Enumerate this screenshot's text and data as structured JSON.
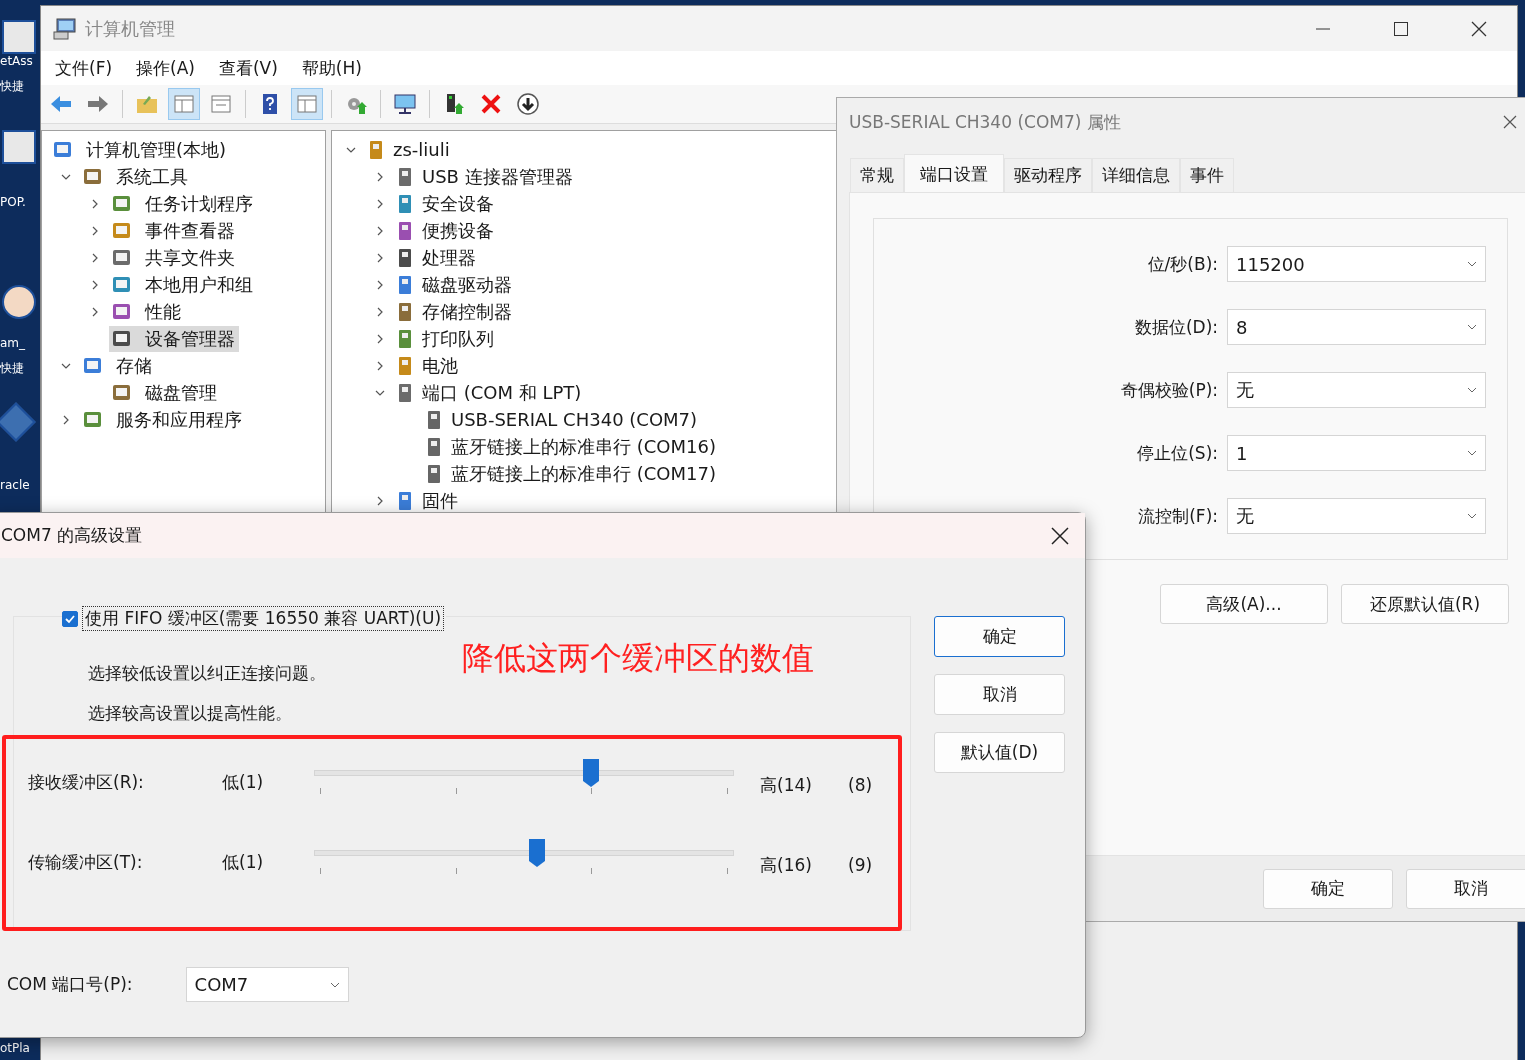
{
  "desktop": {
    "labels": [
      {
        "text": "etAss"
      },
      {
        "text": "快捷"
      },
      {
        "text": "POP."
      },
      {
        "text": "am_"
      },
      {
        "text": "快捷"
      },
      {
        "text": "racle"
      },
      {
        "text": "otPla"
      }
    ]
  },
  "main_window": {
    "title": "计算机管理",
    "menu": [
      "文件(F)",
      "操作(A)",
      "查看(V)",
      "帮助(H)"
    ],
    "toolbar": [
      {
        "kind": "back",
        "selected": false
      },
      {
        "kind": "forward",
        "selected": false
      },
      {
        "kind": "folder",
        "selected": false
      },
      {
        "kind": "tree",
        "selected": true
      },
      {
        "kind": "sheet",
        "selected": false
      },
      {
        "kind": "help",
        "selected": false
      },
      {
        "kind": "pane",
        "selected": true
      },
      {
        "kind": "gear",
        "selected": false
      },
      {
        "kind": "monitor",
        "selected": false
      },
      {
        "kind": "device",
        "selected": false
      },
      {
        "kind": "delete",
        "selected": false
      },
      {
        "kind": "download",
        "selected": false
      }
    ],
    "console_tree": [
      {
        "label": "计算机管理(本地)",
        "selected": false,
        "children": [
          {
            "label": "系统工具",
            "expanded": true,
            "selected": false,
            "children": [
              {
                "label": "任务计划程序",
                "expanded": false,
                "selected": false
              },
              {
                "label": "事件查看器",
                "expanded": false,
                "selected": false
              },
              {
                "label": "共享文件夹",
                "expanded": false,
                "selected": false
              },
              {
                "label": "本地用户和组",
                "expanded": false,
                "selected": false
              },
              {
                "label": "性能",
                "expanded": false,
                "selected": false
              },
              {
                "label": "设备管理器",
                "selected": true
              }
            ]
          },
          {
            "label": "存储",
            "expanded": true,
            "selected": false,
            "children": [
              {
                "label": "磁盘管理",
                "selected": false
              }
            ]
          },
          {
            "label": "服务和应用程序",
            "expanded": false,
            "selected": false
          }
        ]
      }
    ],
    "device_tree": [
      {
        "label": "zs-liuli",
        "expanded": true,
        "children": [
          {
            "label": "USB 连接器管理器",
            "expanded": false
          },
          {
            "label": "安全设备",
            "expanded": false
          },
          {
            "label": "便携设备",
            "expanded": false
          },
          {
            "label": "处理器",
            "expanded": false
          },
          {
            "label": "磁盘驱动器",
            "expanded": false
          },
          {
            "label": "存储控制器",
            "expanded": false
          },
          {
            "label": "打印队列",
            "expanded": false
          },
          {
            "label": "电池",
            "expanded": false
          },
          {
            "label": "端口 (COM 和 LPT)",
            "expanded": true,
            "children": [
              {
                "label": "USB-SERIAL CH340 (COM7)"
              },
              {
                "label": "蓝牙链接上的标准串行 (COM16)"
              },
              {
                "label": "蓝牙链接上的标准串行 (COM17)"
              }
            ]
          },
          {
            "label": "固件",
            "expanded": false
          }
        ]
      }
    ]
  },
  "properties_dialog": {
    "title": "USB-SERIAL CH340 (COM7) 属性",
    "tabs": [
      {
        "label": "常规",
        "selected": false
      },
      {
        "label": "端口设置",
        "selected": true
      },
      {
        "label": "驱动程序",
        "selected": false
      },
      {
        "label": "详细信息",
        "selected": false
      },
      {
        "label": "事件",
        "selected": false
      }
    ],
    "fields": [
      {
        "label": "位/秒(B):",
        "value": "115200"
      },
      {
        "label": "数据位(D):",
        "value": "8"
      },
      {
        "label": "奇偶校验(P):",
        "value": "无"
      },
      {
        "label": "停止位(S):",
        "value": "1"
      },
      {
        "label": "流控制(F):",
        "value": "无"
      }
    ],
    "buttons": [
      "高级(A)...",
      "还原默认值(R)"
    ],
    "footer_buttons": [
      "确定",
      "取消"
    ]
  },
  "advanced_dialog": {
    "title": "COM7 的高级设置",
    "fifo": {
      "label": "使用 FIFO 缓冲区(需要 16550 兼容 UART)(U)",
      "checked": true
    },
    "hints": [
      "选择较低设置以纠正连接问题。",
      "选择较高设置以提高性能。"
    ],
    "buffers": [
      {
        "label": "接收缓冲区(R):",
        "low": "低(1)",
        "high": "高(14)",
        "reading": "(8)",
        "level": 0.66
      },
      {
        "label": "传输缓冲区(T):",
        "low": "低(1)",
        "high": "高(16)",
        "reading": "(9)",
        "level": 0.53
      }
    ],
    "buttons": [
      {
        "label": "确定",
        "default": true
      },
      {
        "label": "取消",
        "default": false
      },
      {
        "label": "默认值(D)",
        "default": false
      }
    ],
    "com_port": {
      "label": "COM 端口号(P):",
      "value": "COM7"
    },
    "annotation": {
      "text": "降低这两个缓冲区的数值"
    }
  }
}
